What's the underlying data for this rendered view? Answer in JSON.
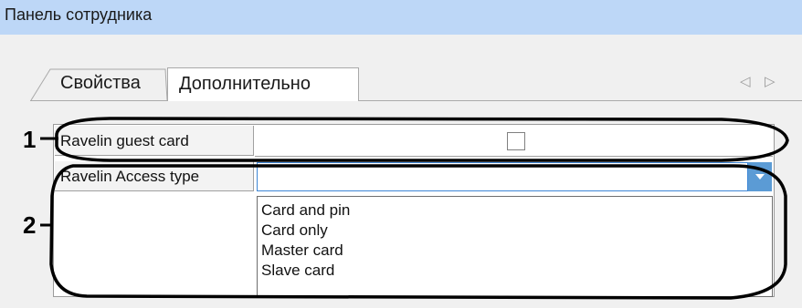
{
  "window": {
    "title": "Панель сотрудника"
  },
  "tabs": [
    {
      "label": "Свойства"
    },
    {
      "label": "Дополнительно"
    }
  ],
  "tab_nav": {
    "prev_icon": "triangle-left-icon",
    "next_icon": "triangle-right-icon",
    "prev_glyph": "◁",
    "next_glyph": "▷"
  },
  "properties": [
    {
      "label": "Ravelin guest card",
      "type": "checkbox",
      "checked": false
    },
    {
      "label": "Ravelin Access type",
      "type": "combobox",
      "value": ""
    }
  ],
  "dropdown": {
    "options": [
      "Card and pin",
      "Card only",
      "Master card",
      "Slave card"
    ]
  },
  "annotations": {
    "marker1": "1",
    "marker2": "2"
  },
  "colors": {
    "titlebar": "#bdd7f7",
    "combo_button": "#5b9bd5",
    "focus_border": "#3d86d6"
  }
}
